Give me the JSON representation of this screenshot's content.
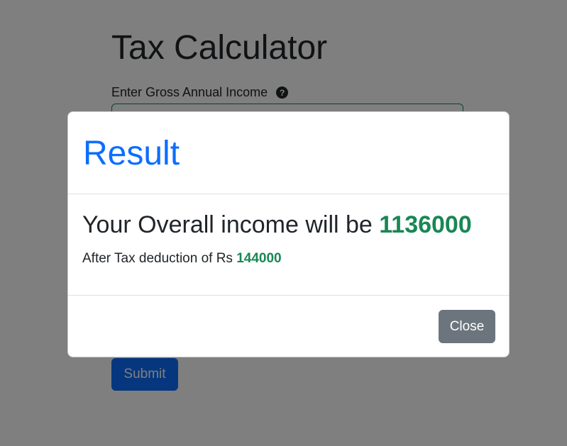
{
  "page": {
    "title": "Tax Calculator",
    "income_label": "Enter Gross Annual Income",
    "help_icon": "?",
    "submit_label": "Submit"
  },
  "modal": {
    "title": "Result",
    "overall_prefix": "Your Overall income will be ",
    "overall_value": "1136000",
    "deduction_prefix": "After Tax deduction of Rs ",
    "deduction_value": "144000",
    "close_label": "Close"
  },
  "colors": {
    "primary": "#0d6efd",
    "success": "#198754",
    "secondary": "#6c757d",
    "backdrop": "rgba(0,0,0,0.5)"
  }
}
